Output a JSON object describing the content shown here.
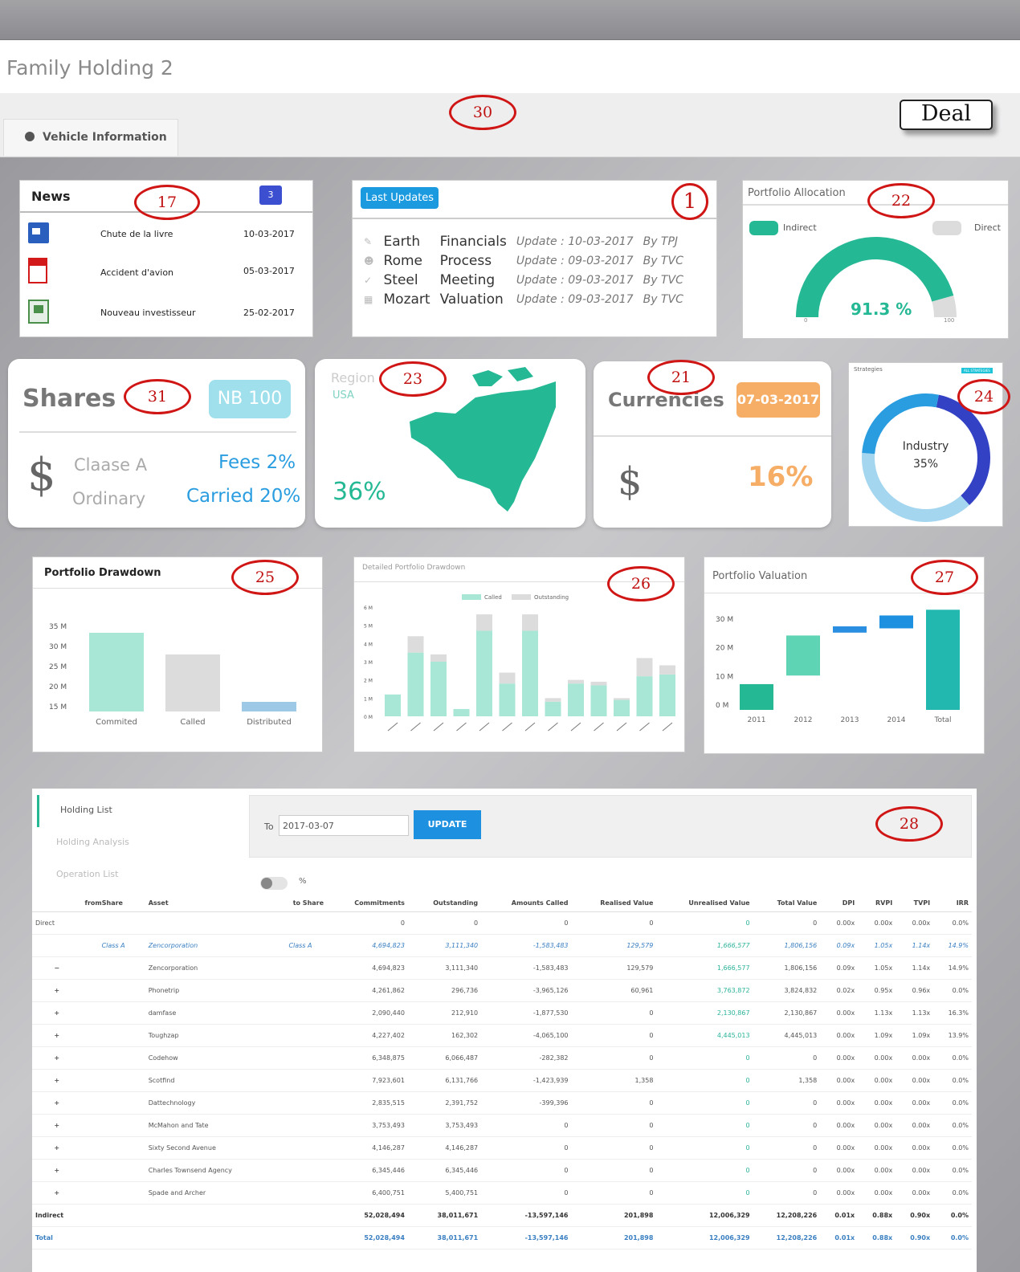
{
  "app": {
    "title": "Family Holding 2",
    "vehicle_tab": "Vehicle Information",
    "deal_button": "Deal"
  },
  "annotations": {
    "vehicle": "30",
    "news": "17",
    "updates": "1",
    "allocation": "22",
    "shares": "31",
    "region": "23",
    "currencies": "21",
    "strategies": "24",
    "drawdown": "25",
    "detailed": "26",
    "valuation": "27",
    "holding": "28"
  },
  "news": {
    "title": "News",
    "badge": "3",
    "items": [
      {
        "icon": "word-doc-icon",
        "title": "Chute de la livre",
        "date": "10-03-2017"
      },
      {
        "icon": "pdf-icon",
        "title": "Accident d'avion",
        "date": "05-03-2017"
      },
      {
        "icon": "excel-icon",
        "title": "Nouveau investisseur",
        "date": "25-02-2017"
      }
    ]
  },
  "last_updates": {
    "title": "Last Updates",
    "rows": [
      {
        "icon": "pencil-icon",
        "name": "Earth",
        "type": "Financials",
        "update": "Update : 10-03-2017",
        "by": "By TPJ"
      },
      {
        "icon": "users-icon",
        "name": "Rome",
        "type": "Process",
        "update": "Update : 09-03-2017",
        "by": "By TVC"
      },
      {
        "icon": "check-icon",
        "name": "Steel",
        "type": "Meeting",
        "update": "Update : 09-03-2017",
        "by": "By TVC"
      },
      {
        "icon": "calendar-icon",
        "name": "Mozart",
        "type": "Valuation",
        "update": "Update : 09-03-2017",
        "by": "By TVC"
      }
    ]
  },
  "allocation": {
    "title": "Portfolio Allocation",
    "legend_indirect": "Indirect",
    "legend_direct": "Direct",
    "value": "91.3 %",
    "fraction": 0.913,
    "min": "0",
    "max": "100"
  },
  "shares": {
    "title": "Shares",
    "badge": "NB 100",
    "class_a": "Claase A",
    "ordinary": "Ordinary",
    "fees": "Fees 2%",
    "carried": "Carried 20%",
    "currency_symbol": "$"
  },
  "region": {
    "title": "Region",
    "subtitle": "USA",
    "value": "36%"
  },
  "currencies": {
    "title": "Currencies",
    "date": "07-03-2017",
    "symbol": "$",
    "value": "16%"
  },
  "strategies": {
    "title": "Strategies",
    "tag": "ALL STRATEGIES",
    "center_label": "Industry",
    "center_value": "35%",
    "segments": [
      35,
      38,
      27
    ]
  },
  "colors": {
    "teal": "#25b894",
    "teal_light": "#a8e6d5",
    "grey": "#dcdcdc",
    "blue_btn": "#1e90e0",
    "navy": "#3341c4",
    "sky": "#2a9de0",
    "pale_sky": "#a4d6ef",
    "orange": "#f6ad66",
    "badge_teal": "#9fe0ec"
  },
  "drawdown_chart": {
    "type": "bar",
    "title": "Portfolio Drawdown",
    "categories": [
      "Commited",
      "Called",
      "Distributed"
    ],
    "values": [
      33.0,
      27.6,
      15.8
    ],
    "ylim": [
      13.4,
      35
    ],
    "yticks": [
      "35 M",
      "30 M",
      "25 M",
      "20 M",
      "15 M"
    ]
  },
  "detailed_chart": {
    "type": "bar",
    "title": "Detailed Portfolio Drawdown",
    "legend": [
      "Called",
      "Outstanding"
    ],
    "yticks": [
      "6 M",
      "5 M",
      "4 M",
      "3 M",
      "2 M",
      "1 M",
      "0 M"
    ],
    "ylim": [
      0,
      6
    ],
    "called": [
      1.2,
      3.5,
      3.0,
      0.4,
      4.7,
      1.8,
      4.7,
      0.8,
      1.8,
      1.7,
      0.9,
      2.2,
      2.3
    ],
    "outstanding": [
      0,
      0.9,
      0.4,
      0,
      0.9,
      0.6,
      0.9,
      0.2,
      0.2,
      0.2,
      0.1,
      1.0,
      0.5
    ]
  },
  "valuation_chart": {
    "type": "bar",
    "title": "Portfolio Valuation",
    "categories": [
      "2011",
      "2012",
      "2013",
      "2014",
      "Total"
    ],
    "yticks": [
      "30 M",
      "20 M",
      "10 M",
      "0 M"
    ],
    "ylim": [
      -2,
      30
    ],
    "ranges": [
      [
        -2,
        7
      ],
      [
        10,
        24
      ],
      [
        25,
        27.2
      ],
      [
        26.5,
        31
      ],
      [
        -2,
        33
      ]
    ]
  },
  "holding": {
    "tabs": [
      "Holding List",
      "Holding Analysis",
      "Operation List"
    ],
    "to_label": "To",
    "date_value": "2017-03-07",
    "update_button": "UPDATE",
    "percent_label": "%",
    "columns": [
      "",
      "fromShare",
      "Asset",
      "to Share",
      "Commitments",
      "Outstanding",
      "Amounts Called",
      "Realised Value",
      "Unrealised Value",
      "Total Value",
      "DPI",
      "RVPI",
      "TVPI",
      "IRR"
    ],
    "rows": [
      {
        "kind": "group",
        "cells": [
          "Direct",
          "",
          "",
          "",
          "0",
          "0",
          "0",
          "0",
          "0",
          "0",
          "0.00x",
          "0.00x",
          "0.00x",
          "0.0%"
        ]
      },
      {
        "kind": "link",
        "cells": [
          "",
          "Class A",
          "Zencorporation",
          "Class A",
          "4,694,823",
          "3,111,340",
          "-1,583,483",
          "129,579",
          "1,666,577",
          "1,806,156",
          "0.09x",
          "1.05x",
          "1.14x",
          "14.9%"
        ]
      },
      {
        "kind": "row",
        "cells": [
          "−",
          "",
          "Zencorporation",
          "",
          "4,694,823",
          "3,111,340",
          "-1,583,483",
          "129,579",
          "1,666,577",
          "1,806,156",
          "0.09x",
          "1.05x",
          "1.14x",
          "14.9%"
        ]
      },
      {
        "kind": "row",
        "cells": [
          "+",
          "",
          "Phonetrip",
          "",
          "4,261,862",
          "296,736",
          "-3,965,126",
          "60,961",
          "3,763,872",
          "3,824,832",
          "0.02x",
          "0.95x",
          "0.96x",
          "0.0%"
        ]
      },
      {
        "kind": "row",
        "cells": [
          "+",
          "",
          "damfase",
          "",
          "2,090,440",
          "212,910",
          "-1,877,530",
          "0",
          "2,130,867",
          "2,130,867",
          "0.00x",
          "1.13x",
          "1.13x",
          "16.3%"
        ]
      },
      {
        "kind": "row",
        "cells": [
          "+",
          "",
          "Toughzap",
          "",
          "4,227,402",
          "162,302",
          "-4,065,100",
          "0",
          "4,445,013",
          "4,445,013",
          "0.00x",
          "1.09x",
          "1.09x",
          "13.9%"
        ]
      },
      {
        "kind": "row",
        "cells": [
          "+",
          "",
          "Codehow",
          "",
          "6,348,875",
          "6,066,487",
          "-282,382",
          "0",
          "0",
          "0",
          "0.00x",
          "0.00x",
          "0.00x",
          "0.0%"
        ]
      },
      {
        "kind": "row",
        "cells": [
          "+",
          "",
          "Scotfind",
          "",
          "7,923,601",
          "6,131,766",
          "-1,423,939",
          "1,358",
          "0",
          "1,358",
          "0.00x",
          "0.00x",
          "0.00x",
          "0.0%"
        ]
      },
      {
        "kind": "row",
        "cells": [
          "+",
          "",
          "Dattechnology",
          "",
          "2,835,515",
          "2,391,752",
          "-399,396",
          "0",
          "0",
          "0",
          "0.00x",
          "0.00x",
          "0.00x",
          "0.0%"
        ]
      },
      {
        "kind": "row",
        "cells": [
          "+",
          "",
          "McMahon and Tate",
          "",
          "3,753,493",
          "3,753,493",
          "0",
          "0",
          "0",
          "0",
          "0.00x",
          "0.00x",
          "0.00x",
          "0.0%"
        ]
      },
      {
        "kind": "row",
        "cells": [
          "+",
          "",
          "Sixty Second Avenue",
          "",
          "4,146,287",
          "4,146,287",
          "0",
          "0",
          "0",
          "0",
          "0.00x",
          "0.00x",
          "0.00x",
          "0.0%"
        ]
      },
      {
        "kind": "row",
        "cells": [
          "+",
          "",
          "Charles Townsend Agency",
          "",
          "6,345,446",
          "6,345,446",
          "0",
          "0",
          "0",
          "0",
          "0.00x",
          "0.00x",
          "0.00x",
          "0.0%"
        ]
      },
      {
        "kind": "row",
        "cells": [
          "+",
          "",
          "Spade and Archer",
          "",
          "6,400,751",
          "5,400,751",
          "0",
          "0",
          "0",
          "0",
          "0.00x",
          "0.00x",
          "0.00x",
          "0.0%"
        ]
      },
      {
        "kind": "sum",
        "cells": [
          "Indirect",
          "",
          "",
          "",
          "52,028,494",
          "38,011,671",
          "-13,597,146",
          "201,898",
          "12,006,329",
          "12,208,226",
          "0.01x",
          "0.88x",
          "0.90x",
          "0.0%"
        ]
      },
      {
        "kind": "tot",
        "cells": [
          "Total",
          "",
          "",
          "",
          "52,028,494",
          "38,011,671",
          "-13,597,146",
          "201,898",
          "12,006,329",
          "12,208,226",
          "0.01x",
          "0.88x",
          "0.90x",
          "0.0%"
        ]
      }
    ]
  }
}
